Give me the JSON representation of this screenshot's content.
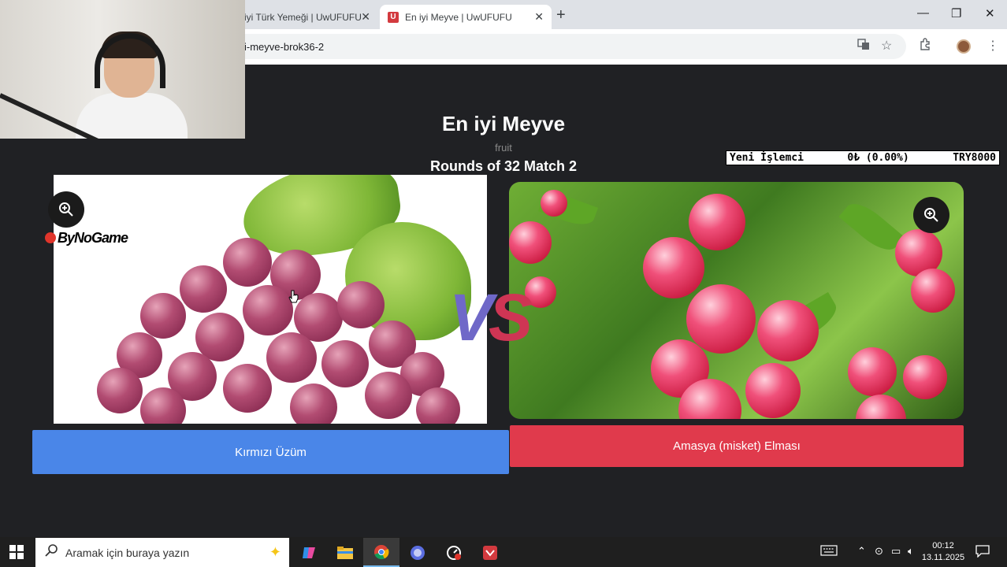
{
  "browser": {
    "tabs": [
      {
        "label": "iyi Türk Yemeği | UwUFUFU",
        "active": false
      },
      {
        "label": "En iyi Meyve | UwUFUFU",
        "active": true
      }
    ],
    "url": "i-meyve-brok36-2"
  },
  "page": {
    "title": "En iyi Meyve",
    "subtitle": "fruit",
    "round_info": "Rounds of 32 Match 2",
    "left_choice": {
      "label": "Kırmızı Üzüm",
      "color": "#4a86e8"
    },
    "right_choice": {
      "label": "Amasya (misket) Elması",
      "color": "#e03a4c"
    },
    "vs_v": "V",
    "vs_s": "S",
    "logo_text": "ByNoGame"
  },
  "ticker": {
    "name": "Yeni İşlemci",
    "amount": "0₺ (0.00%)",
    "goal": "TRY8000"
  },
  "taskbar": {
    "search_placeholder": "Aramak için buraya yazın",
    "time": "00:12",
    "date": "13.11.2025"
  },
  "icons": [
    "zoom-in-icon",
    "close-icon",
    "plus-icon",
    "translate-icon",
    "star-icon",
    "extensions-icon",
    "menu-icon",
    "windows-icon",
    "search-icon"
  ]
}
